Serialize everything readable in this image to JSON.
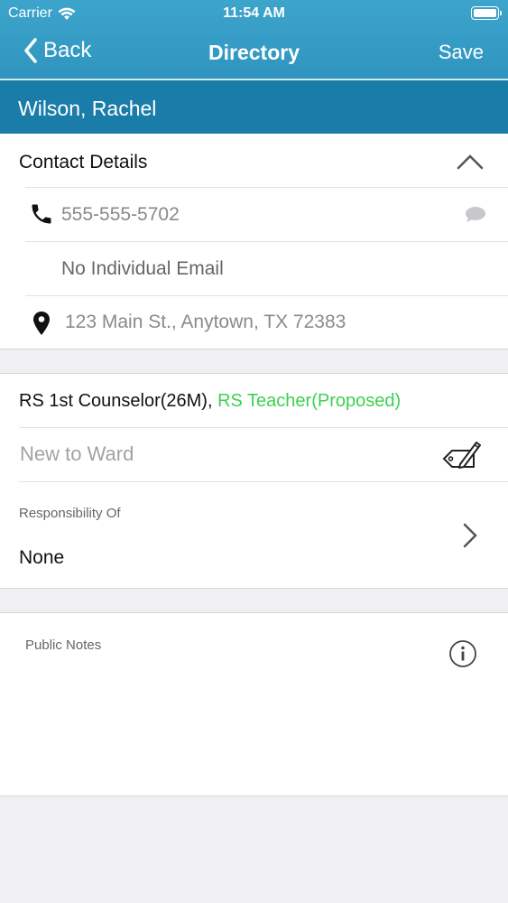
{
  "status_bar": {
    "carrier": "Carrier",
    "time": "11:54 AM"
  },
  "nav": {
    "back_label": "Back",
    "title": "Directory",
    "save_label": "Save"
  },
  "person": {
    "name": "Wilson, Rachel"
  },
  "contact": {
    "section_title": "Contact Details",
    "phone": "555-555-5702",
    "email": "No Individual Email",
    "address": "123 Main St., Anytown, TX 72383"
  },
  "callings": {
    "primary": "RS 1st Counselor(26M), ",
    "proposed": "RS Teacher(Proposed)",
    "tag_placeholder": "New to Ward",
    "responsibility_label": "Responsibility Of",
    "responsibility_value": "None"
  },
  "notes": {
    "label": "Public Notes"
  },
  "colors": {
    "nav_bar": "#3da4cb",
    "name_bar": "#1a7ca8",
    "proposed": "#3cd151",
    "background": "#efeff4"
  }
}
